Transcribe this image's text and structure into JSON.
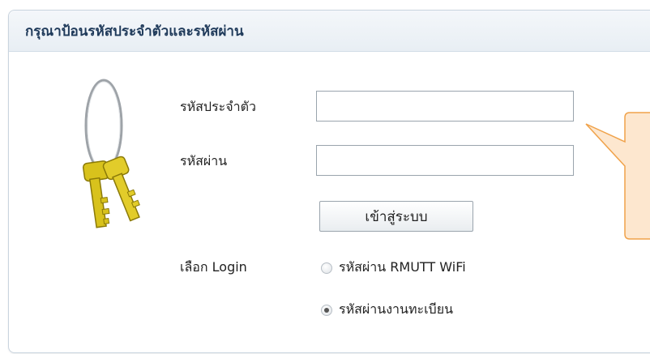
{
  "panel": {
    "title": "กรุณาป้อนรหัสประจำตัวและรหัสผ่าน"
  },
  "form": {
    "id_label": "รหัสประจำตัว",
    "id_value": "",
    "password_label": "รหัสผ่าน",
    "password_value": "",
    "login_button": "เข้าสู่ระบบ",
    "login_type_label": "เลือก Login",
    "options": [
      {
        "label": "รหัสผ่าน RMUTT WiFi",
        "selected": false
      },
      {
        "label": "รหัสผ่านงานทะเบียน",
        "selected": true
      }
    ]
  },
  "icons": {
    "keys": "keys-icon"
  },
  "colors": {
    "header_text": "#1f3a5a",
    "tooltip_bg": "#fde7cf",
    "tooltip_border": "#f0a24a"
  }
}
